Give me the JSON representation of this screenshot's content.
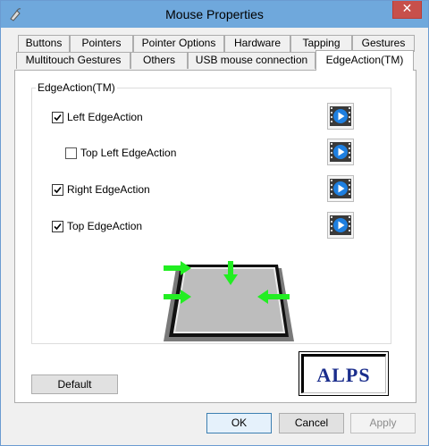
{
  "window": {
    "title": "Mouse Properties",
    "close_glyph": "✕"
  },
  "tabs": {
    "row1": [
      "Buttons",
      "Pointers",
      "Pointer Options",
      "Hardware",
      "Tapping",
      "Gestures"
    ],
    "row2": [
      "Multitouch Gestures",
      "Others",
      "USB mouse connection",
      "EdgeAction(TM)"
    ],
    "active": "EdgeAction(TM)"
  },
  "group": {
    "legend": "EdgeAction(TM)",
    "options": [
      {
        "label": "Left EdgeAction",
        "checked": true,
        "enabled": true
      },
      {
        "label": "Top Left EdgeAction",
        "checked": false,
        "enabled": true
      },
      {
        "label": "Right EdgeAction",
        "checked": true,
        "enabled": true
      },
      {
        "label": "Top EdgeAction",
        "checked": true,
        "enabled": true
      }
    ],
    "play_icon": "play-video-icon"
  },
  "default_button": "Default",
  "logo": "ALPS",
  "footer": {
    "ok": "OK",
    "cancel": "Cancel",
    "apply": "Apply",
    "apply_enabled": false
  },
  "colors": {
    "titlebar": "#6fa8dc",
    "close": "#c7504b",
    "arrow": "#22ee22",
    "logo_text": "#1a2d8c"
  }
}
